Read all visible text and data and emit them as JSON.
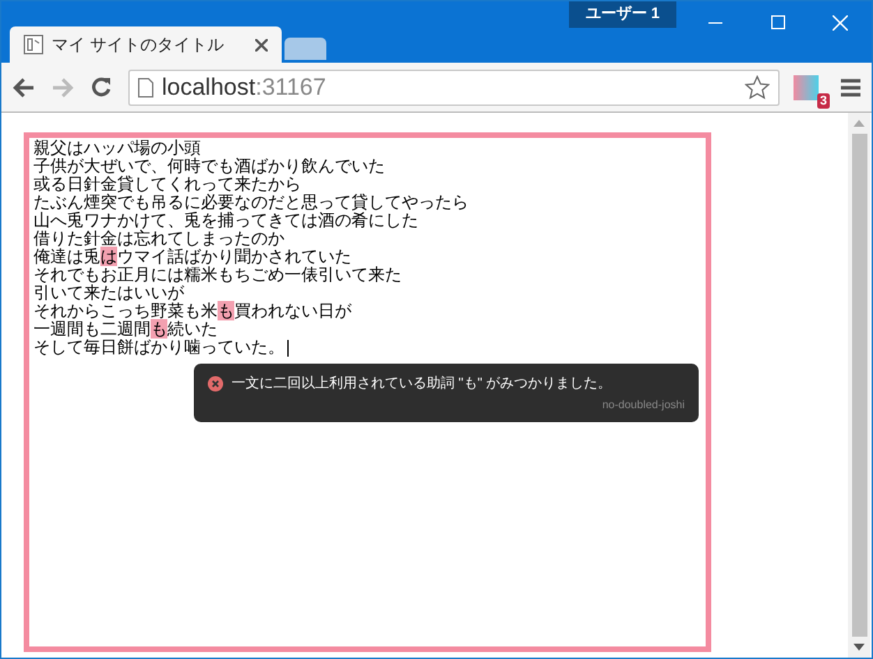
{
  "window": {
    "profile": "ユーザー 1"
  },
  "tabs": [
    {
      "title": "マイ サイトのタイトル",
      "selected": true
    },
    {
      "selected": false
    }
  ],
  "address_bar": {
    "host": "localhost",
    "port": ":31167"
  },
  "extension": {
    "badge": "3"
  },
  "editor": {
    "lines": [
      [
        {
          "text": "親父はハッパ場の小頭",
          "marked": false
        }
      ],
      [
        {
          "text": "子供が大ぜいで、何時でも酒ばかり飲んでいた",
          "marked": false
        }
      ],
      [
        {
          "text": "或る日針金貸してくれって来たから",
          "marked": false
        }
      ],
      [
        {
          "text": "たぶん煙突でも吊るに必要なのだと思って貸してやったら",
          "marked": false
        }
      ],
      [
        {
          "text": "山へ兎ワナかけて、兎を捕ってきては酒の肴にした",
          "marked": false
        }
      ],
      [
        {
          "text": "借りた針金は忘れてしまったのか",
          "marked": false
        }
      ],
      [
        {
          "text": "俺達は兎",
          "marked": false
        },
        {
          "text": "は",
          "marked": true
        },
        {
          "text": "ウマイ話ばかり聞かされていた",
          "marked": false
        }
      ],
      [
        {
          "text": "それでもお正月には糯米もちごめ一俵引いて来た",
          "marked": false
        }
      ],
      [
        {
          "text": "引いて来たはいいが",
          "marked": false
        }
      ],
      [
        {
          "text": "それからこっち野菜も米",
          "marked": false
        },
        {
          "text": "も",
          "marked": true
        },
        {
          "text": "買われない日が",
          "marked": false
        }
      ],
      [
        {
          "text": "一週間も二週間",
          "marked": false
        },
        {
          "text": "も",
          "marked": true
        },
        {
          "text": "続いた",
          "marked": false
        }
      ],
      [
        {
          "text": "そして毎日餅ばかり噛っていた。",
          "marked": false
        }
      ]
    ],
    "error": true
  },
  "tooltip": {
    "message": "一文に二回以上利用されている助詞 \"も\" がみつかりました。",
    "rule": "no-doubled-joshi"
  }
}
